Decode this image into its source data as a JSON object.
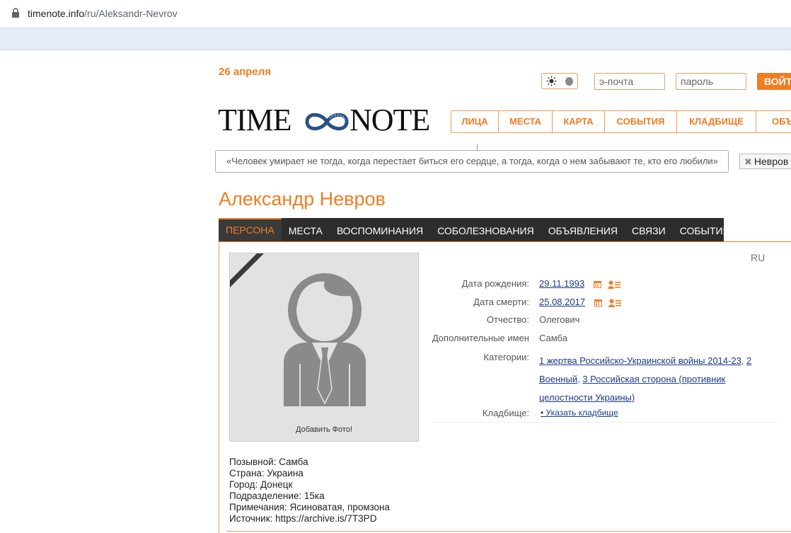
{
  "browser": {
    "url_host": "timenote.info",
    "url_path": "/ru/Aleksandr-Nevrov"
  },
  "header": {
    "date": "26 апреля",
    "email_placeholder": "э-почта",
    "password_placeholder": "пароль",
    "login_label": "ВОЙТИ",
    "logo_left": "TIME",
    "logo_right": "NOTE"
  },
  "main_nav": {
    "items": [
      {
        "label": "ЛИЦА"
      },
      {
        "label": "МЕСТА"
      },
      {
        "label": "КАРТА"
      },
      {
        "label": "СОБЫТИЯ"
      },
      {
        "label": "КЛАДБИЩЕ"
      },
      {
        "label": "ОБЪЯВЛЕНИЯ"
      }
    ]
  },
  "quote": "«Человек умирает не тогда, когда перестает биться его сердце, а тогда, когда о нем забывают те, кто его любили»",
  "search_chip": "Невров",
  "person": {
    "name": "Александр Невров",
    "tabs": [
      {
        "label": "ПЕРСОНА",
        "active": true
      },
      {
        "label": "МЕСТА"
      },
      {
        "label": "ВОСПОМИНАНИЯ"
      },
      {
        "label": "СОБОЛЕЗНОВАНИЯ"
      },
      {
        "label": "ОБЪЯВЛЕНИЯ"
      },
      {
        "label": "СВЯЗИ"
      },
      {
        "label": "СОБЫТИЯ"
      }
    ],
    "lang": "RU",
    "add_photo": "Добавить Фото!",
    "info": {
      "birth_label": "Дата рождения:",
      "birth_value": "29.11.1993",
      "death_label": "Дата смерти:",
      "death_value": "25.08.2017",
      "patronymic_label": "Отчество:",
      "patronymic_value": "Олегович",
      "extra_names_label": "Дополнительные имен",
      "extra_names_value": "Самба",
      "categories_label": "Категории:",
      "categories": [
        "1 жертва Российско-Украинской войны 2014-23",
        "2 Военный",
        "3 Российская сторона (противник целостности Украины)"
      ],
      "cemetery_label": "Кладбище:",
      "cemetery_value": "• Указать кладбище"
    },
    "bio": [
      "Позывной: Самба",
      "Страна: Украина",
      "Город: Донецк",
      "Подразделение: 15ка",
      "Примечания: Ясиноватая, промзона",
      "Источник: https://archive.is/7T3PD"
    ]
  },
  "colors": {
    "accent": "#f07d22",
    "dark_tab_bar": "#2d2d2d",
    "link": "#1a3a8a"
  }
}
